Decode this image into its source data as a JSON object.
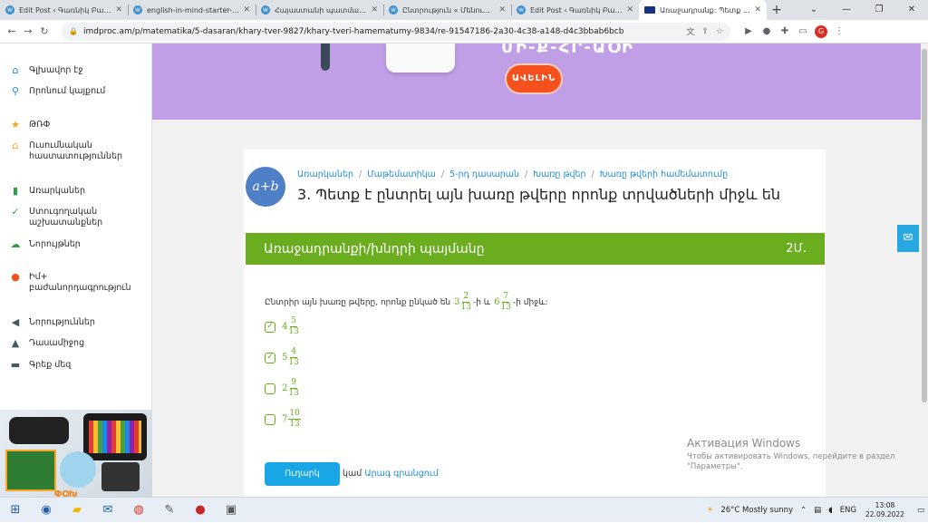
{
  "browser": {
    "tabs": [
      {
        "title": "Edit Post ‹ Գառնիկ Բարսեղյան"
      },
      {
        "title": "english-in-mind-starter-1.pdf"
      },
      {
        "title": "Հայաստանի պատմական"
      },
      {
        "title": "Ընտրություն « Մենուա 2023"
      },
      {
        "title": "Edit Post ‹ Գառնիկ Բարսեղյան"
      },
      {
        "title": "Առաջադրանք: Պետք է ը"
      }
    ],
    "url": "imdproc.am/p/matematika/5-dasaran/khary-tver-9827/khary-tveri-hamematumy-9834/re-91547186-2a30-4c38-a148-d4c3bbab6bcb",
    "profile_letter": "G"
  },
  "sidebar": {
    "items": [
      {
        "label": "Գլխավոր էջ"
      },
      {
        "label": "Որոնում կայքում"
      },
      {
        "label": "ԹՌՓ"
      },
      {
        "label": "Ուսումնական հաստատություններ"
      },
      {
        "label": "Առարկաներ"
      },
      {
        "label": "Ստուգողական աշխատանքներ"
      },
      {
        "label": "Նորույթներ"
      },
      {
        "label": "Իմ+ բաժանորդագրություն"
      },
      {
        "label": "Նորություններ"
      },
      {
        "label": "Դասամիջոց"
      },
      {
        "label": "Գրեք մեզ"
      }
    ],
    "ad_text": "ՓՕԽ"
  },
  "banner": {
    "headline": "ՄԻ-Ք-ՀՐ-ԱՕԻ",
    "button_label": "ԱՎԵԼԻՆ"
  },
  "lesson": {
    "avatar_text": "a+b",
    "breadcrumbs": [
      "Առարկաներ",
      "Մաթեմատիկա",
      "5-րդ դասարան",
      "Խառը թվեր",
      "Խառը թվերի համեմատումը"
    ],
    "title": "3. Պետք է ընտրել այն խառը թվերը որոնք տրվածների միջև են",
    "section_header": "Առաջադրանքի/խնդրի պայմանը",
    "points": "2Մ.",
    "task_text_before": "Ընտրիր այն խառը թվերը, որոնք ընկած են",
    "task_text_middle": "-ի և",
    "task_text_after": "-ի միջև:",
    "bound1": {
      "whole": "3",
      "num": "2",
      "den": "13"
    },
    "bound2": {
      "whole": "6",
      "num": "7",
      "den": "13"
    },
    "options": [
      {
        "whole": "4",
        "num": "5",
        "den": "13",
        "checked": true,
        "mark": "✓"
      },
      {
        "whole": "5",
        "num": "4",
        "den": "13",
        "checked": true,
        "mark": "✓"
      },
      {
        "whole": "2",
        "num": "9",
        "den": "13",
        "checked": false,
        "mark": ""
      },
      {
        "whole": "7",
        "num": "10",
        "den": "13",
        "checked": false,
        "mark": ""
      }
    ],
    "submit_label": "Ուղարկ",
    "or_text": "կամ",
    "skip_link": "Արագ գրանցում"
  },
  "watermark": {
    "line1": "Активация Windows",
    "line2": "Чтобы активировать Windows, перейдите в раздел",
    "line3": "\"Параметры\"."
  },
  "taskbar": {
    "weather": "26°C  Mostly sunny",
    "lang": "ENG",
    "time": "13:08",
    "date": "22.09.2022"
  }
}
